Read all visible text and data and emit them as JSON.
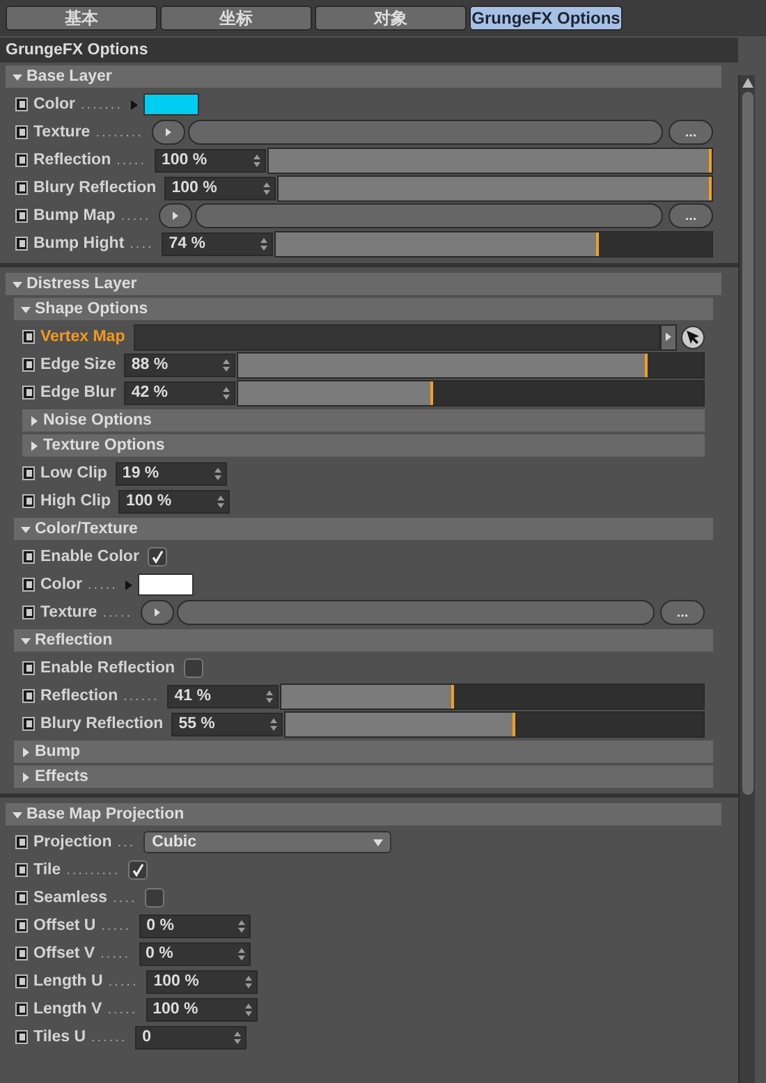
{
  "tabs": [
    {
      "label": "基本",
      "selected": false
    },
    {
      "label": "坐标",
      "selected": false
    },
    {
      "label": "对象",
      "selected": false
    },
    {
      "label": "GrungeFX Options",
      "selected": true
    }
  ],
  "title": "GrungeFX Options",
  "sections": [
    {
      "kind": "group",
      "title": "Base Layer",
      "expanded": true,
      "items": [
        {
          "kind": "color",
          "label": "Color",
          "dots": ".......",
          "color": "#00cdf2"
        },
        {
          "kind": "texture",
          "label": "Texture",
          "dots": "........",
          "button": "..."
        },
        {
          "kind": "slider",
          "label": "Reflection",
          "dots": ".....",
          "value": "100 %",
          "level": 1
        },
        {
          "kind": "slider",
          "label": "Blury Reflection",
          "value": "100 %",
          "level": 1
        },
        {
          "kind": "texture",
          "label": "Bump Map",
          "dots": ".....",
          "button": "..."
        },
        {
          "kind": "slider",
          "label": "Bump Hight",
          "dots": "....",
          "value": "74 %",
          "level": 0.74
        }
      ]
    },
    {
      "kind": "group",
      "title": "Distress Layer",
      "expanded": true,
      "items": [
        {
          "kind": "group",
          "title": "Shape Options",
          "expanded": true,
          "items": [
            {
              "kind": "link",
              "label": "Vertex Map"
            },
            {
              "kind": "slider",
              "label": "Edge Size",
              "value": "88 %",
              "level": 0.88
            },
            {
              "kind": "slider",
              "label": "Edge Blur",
              "value": "42 %",
              "level": 0.42
            },
            {
              "kind": "group",
              "title": "Noise Options",
              "expanded": false
            },
            {
              "kind": "group",
              "title": "Texture Options",
              "expanded": false
            },
            {
              "kind": "number",
              "label": "Low Clip",
              "value": "19 %"
            },
            {
              "kind": "number",
              "label": "High Clip",
              "value": "100 %"
            }
          ]
        },
        {
          "kind": "group",
          "title": "Color/Texture",
          "expanded": true,
          "items": [
            {
              "kind": "checkbox",
              "label": "Enable Color",
              "checked": true
            },
            {
              "kind": "color",
              "label": "Color",
              "dots": ".....",
              "color": "#ffffff"
            },
            {
              "kind": "texture",
              "label": "Texture",
              "dots": ".....",
              "button": "..."
            }
          ]
        },
        {
          "kind": "group",
          "title": "Reflection",
          "expanded": true,
          "items": [
            {
              "kind": "checkbox",
              "label": "Enable Reflection",
              "checked": false
            },
            {
              "kind": "slider",
              "label": "Reflection",
              "dots": "......",
              "value": "41 %",
              "level": 0.41
            },
            {
              "kind": "slider",
              "label": "Blury Reflection",
              "value": "55 %",
              "level": 0.55
            }
          ]
        },
        {
          "kind": "group",
          "title": "Bump",
          "expanded": false
        },
        {
          "kind": "group",
          "title": "Effects",
          "expanded": false
        }
      ]
    },
    {
      "kind": "group",
      "title": "Base Map Projection",
      "expanded": true,
      "items": [
        {
          "kind": "dropdown",
          "label": "Projection",
          "dots": "...",
          "value": "Cubic"
        },
        {
          "kind": "checkbox",
          "label": "Tile",
          "dots": ".........",
          "checked": true
        },
        {
          "kind": "checkbox",
          "label": "Seamless",
          "dots": "....",
          "checked": false
        },
        {
          "kind": "number",
          "label": "Offset U",
          "dots": ".....",
          "value": "0 %"
        },
        {
          "kind": "number",
          "label": "Offset V",
          "dots": ".....",
          "value": "0 %"
        },
        {
          "kind": "number",
          "label": "Length U",
          "dots": ".....",
          "value": "100 %"
        },
        {
          "kind": "number",
          "label": "Length V",
          "dots": ".....",
          "value": "100 %"
        },
        {
          "kind": "number",
          "label": "Tiles U",
          "dots": "......",
          "value": "0"
        }
      ]
    }
  ]
}
